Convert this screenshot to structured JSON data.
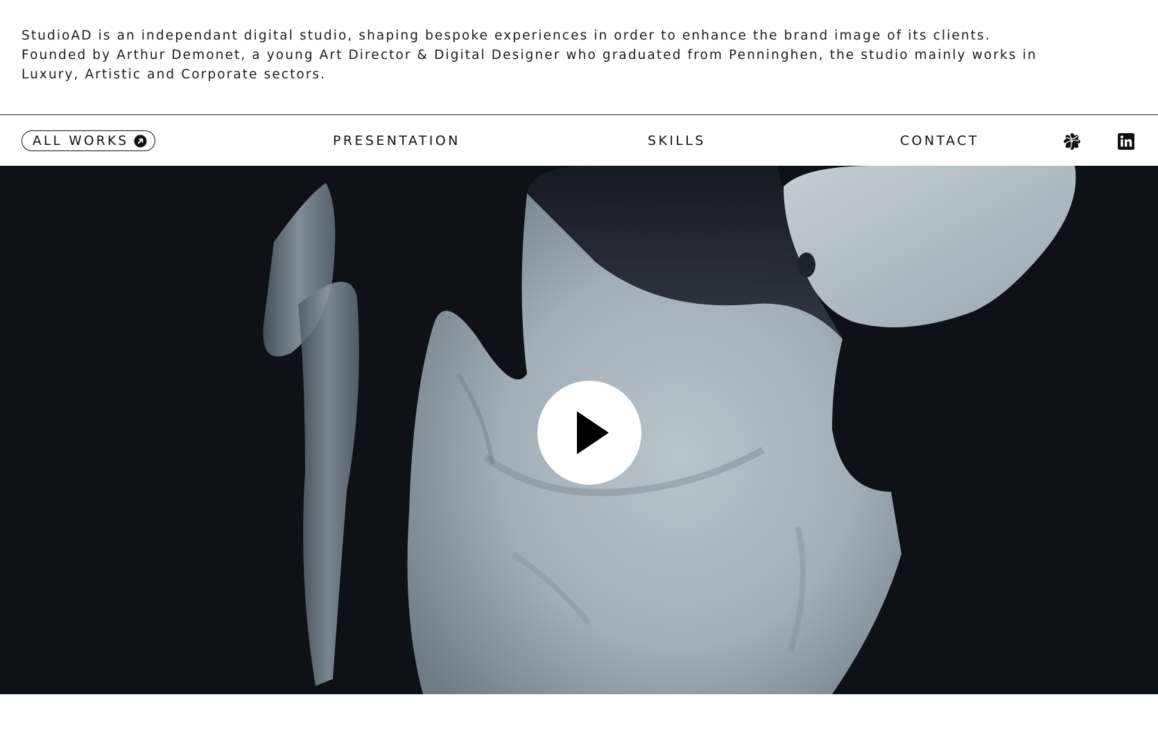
{
  "intro": {
    "text": "StudioAD is an independant digital studio, shaping bespoke experiences in order to enhance the brand image of its clients. Founded by Arthur Demonet, a young Art Director & Digital Designer who graduated from Penninghen, the studio mainly works in Luxury, Artistic and Corporate sectors."
  },
  "nav": {
    "all_works_label": "ALL WORKS",
    "presentation_label": "PRESENTATION",
    "skills_label": "SKILLS",
    "contact_label": "CONTACT",
    "icons": [
      "arrow-up-right-icon",
      "dribbble-icon",
      "linkedin-icon"
    ]
  },
  "hero": {
    "media": "video",
    "subject": "sculpture-torso",
    "play_icon": "play-icon"
  },
  "colors": {
    "text": "#111111",
    "background": "#ffffff",
    "hero_background": "#0e1117",
    "sculpture": "#a9b4bd"
  }
}
